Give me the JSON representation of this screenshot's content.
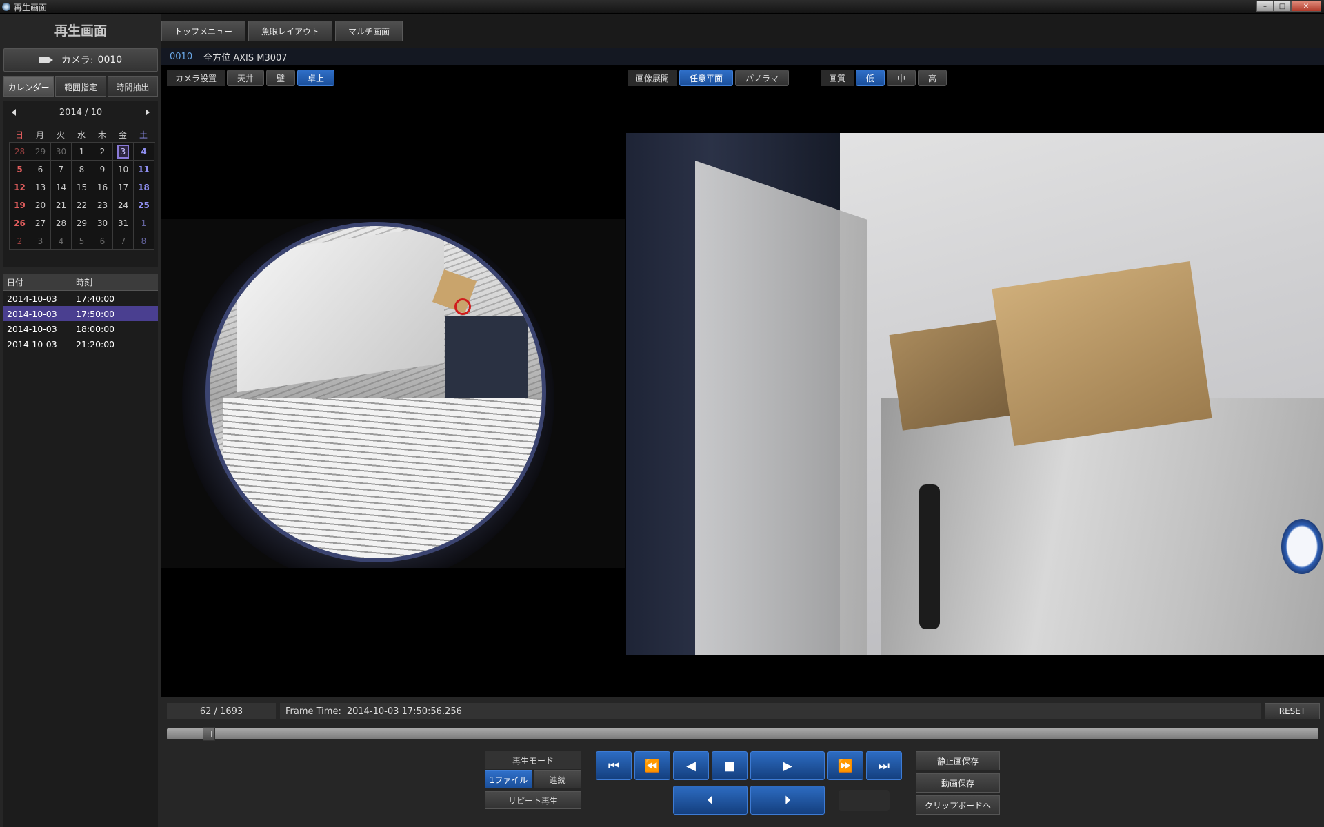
{
  "window": {
    "title": "再生画面",
    "controls": {
      "minimize": "–",
      "maximize": "□",
      "close": "✕"
    }
  },
  "sidebar": {
    "screen_title": "再生画面",
    "camera_selector": {
      "label": "カメラ:",
      "value": "0010",
      "icon": "video-camera-icon"
    },
    "tabs": [
      {
        "label": "カレンダー",
        "active": true
      },
      {
        "label": "範囲指定",
        "active": false
      },
      {
        "label": "時間抽出",
        "active": false
      }
    ],
    "calendar": {
      "month_label": "2014 / 10",
      "weekdays": [
        "日",
        "月",
        "火",
        "水",
        "木",
        "金",
        "土"
      ],
      "weeks": [
        [
          "28",
          "29",
          "30",
          "1",
          "2",
          "3",
          "4"
        ],
        [
          "5",
          "6",
          "7",
          "8",
          "9",
          "10",
          "11"
        ],
        [
          "12",
          "13",
          "14",
          "15",
          "16",
          "17",
          "18"
        ],
        [
          "19",
          "20",
          "21",
          "22",
          "23",
          "24",
          "25"
        ],
        [
          "26",
          "27",
          "28",
          "29",
          "30",
          "31",
          "1"
        ],
        [
          "2",
          "3",
          "4",
          "5",
          "6",
          "7",
          "8"
        ]
      ],
      "selected_day": "3"
    },
    "recordings": {
      "headers": {
        "date": "日付",
        "time": "時刻"
      },
      "rows": [
        {
          "date": "2014-10-03",
          "time": "17:40:00",
          "selected": false
        },
        {
          "date": "2014-10-03",
          "time": "17:50:00",
          "selected": true
        },
        {
          "date": "2014-10-03",
          "time": "18:00:00",
          "selected": false
        },
        {
          "date": "2014-10-03",
          "time": "21:20:00",
          "selected": false
        }
      ]
    }
  },
  "top_nav": [
    {
      "label": "トップメニュー"
    },
    {
      "label": "魚眼レイアウト"
    },
    {
      "label": "マルチ画面"
    }
  ],
  "camera_info": {
    "id": "0010",
    "name": "全方位 AXIS M3007"
  },
  "controls": {
    "camera_mount": {
      "label": "カメラ設置",
      "options": [
        {
          "label": "天井",
          "active": false
        },
        {
          "label": "壁",
          "active": false
        },
        {
          "label": "卓上",
          "active": true
        }
      ]
    },
    "dewarp": {
      "label": "画像展開",
      "options": [
        {
          "label": "任意平面",
          "active": true
        },
        {
          "label": "パノラマ",
          "active": false
        }
      ]
    },
    "quality": {
      "label": "画質",
      "options": [
        {
          "label": "低",
          "active": true
        },
        {
          "label": "中",
          "active": false
        },
        {
          "label": "高",
          "active": false
        }
      ]
    }
  },
  "playback": {
    "frame_counter": "62 / 1693",
    "frame_time_label": "Frame Time:",
    "frame_time_value": "2014-10-03 17:50:56.256",
    "reset_label": "RESET",
    "timeline_position": 0.0366,
    "mode": {
      "label": "再生モード",
      "options": [
        {
          "label": "1ファイル",
          "active": true
        },
        {
          "label": "連続",
          "active": false
        }
      ],
      "repeat_label": "リピート再生"
    },
    "buttons": {
      "first": "⏮",
      "rewind": "⏪",
      "step_back": "◀",
      "stop": "■",
      "play": "▶",
      "fast_forward": "⏩",
      "last": "⏭",
      "prev_frame": "⏴",
      "next_frame": "⏵"
    },
    "save": {
      "still": "静止画保存",
      "video": "動画保存",
      "clipboard": "クリップボードへ"
    }
  },
  "colors": {
    "accent_blue": "#1b4f9a",
    "selection_purple": "#4a3f90",
    "target_red": "#d01d1d"
  }
}
